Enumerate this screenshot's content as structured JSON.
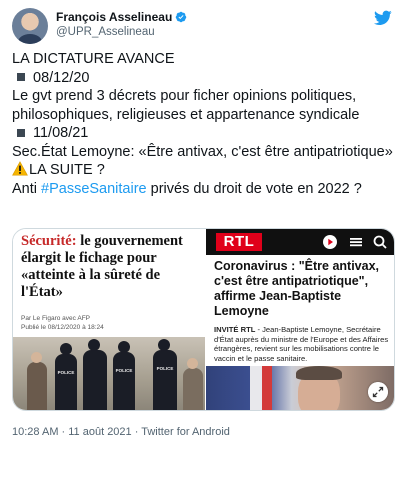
{
  "author": {
    "name": "François Asselineau",
    "handle": "@UPR_Asselineau",
    "verified_icon": "verified-badge-icon",
    "logo_icon": "twitter-bird-icon",
    "accent_color": "#1d9bf0"
  },
  "tweet": {
    "line1": "LA DICTATURE AVANCE",
    "date1": "08/12/20",
    "line3": "Le gvt prend 3 décrets pour ficher opinions politiques, philosophiques, religieuses et appartenance syndicale",
    "date2": "11/08/21",
    "line5": "Sec.État Lemoyne: «Être antivax, c'est être antipatriotique»",
    "warning_icon": "warning-sign-icon",
    "line6": "LA SUITE ?",
    "line7_before": "Anti ",
    "hashtag": "#PasseSanitaire",
    "line7_after": " privés du droit de vote en 2022 ?"
  },
  "media": {
    "left": {
      "title_accent": "Sécurité:",
      "title_rest": " le gouvernement élargit le fichage pour «atteinte à la sûreté de l'État»",
      "source": "Par Le Figaro avec AFP",
      "published": "Publié le 08/12/2020 à 18:24",
      "photo_labels": [
        "POLICE",
        "POLICE",
        "POLICE"
      ]
    },
    "right": {
      "brand": "RTL",
      "title": "Coronavirus : \"Être antivax, c'est être antipatriotique\", affirme Jean-Baptiste Lemoyne",
      "desc_bold": "INVITÉ RTL",
      "desc_rest": " - Jean-Baptiste Lemoyne, Secrétaire d'État auprès du ministre de l'Europe et des Affaires étrangères, revient sur les mobilisations contre le vaccin et le passe sanitaire.",
      "brand_color": "#e0001a"
    }
  },
  "footer": {
    "text": "10:28 AM · 11 août 2021 · Twitter for Android"
  }
}
